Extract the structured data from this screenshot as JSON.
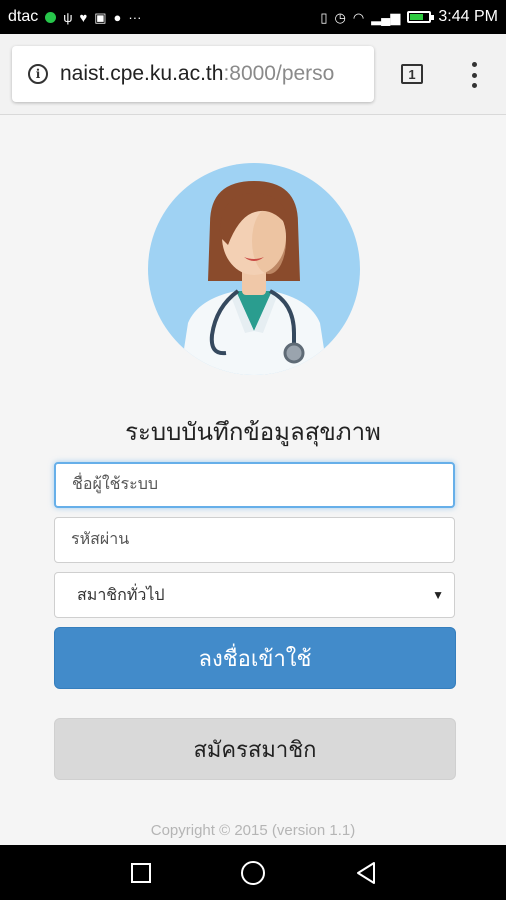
{
  "status_bar": {
    "carrier": "dtac",
    "time": "3:44 PM",
    "battery_level": 0.7,
    "icons": [
      "notification-dot-icon",
      "usb-icon",
      "health-icon",
      "app-icon",
      "chat-icon",
      "more-icon",
      "vibrate-icon",
      "alarm-icon",
      "wifi-icon",
      "signal-icon",
      "battery-icon"
    ],
    "more_glyph": "···"
  },
  "browser": {
    "url_host": "naist.cpe.ku.ac.th",
    "url_rest": ":8000/perso",
    "tab_count": "1"
  },
  "page": {
    "title": "ระบบบันทึกข้อมูลสุขภาพ",
    "username_placeholder": "ชื่อผู้ใช้ระบบ",
    "password_placeholder": "รหัสผ่าน",
    "member_type": "สมาชิกทั่วไป",
    "login_label": "ลงชื่อเข้าใช้",
    "register_label": "สมัครสมาชิก",
    "copyright": "Copyright © 2015 (version 1.1)"
  },
  "colors": {
    "primary": "#428bca",
    "avatar_bg": "#9fd2f3",
    "focus_border": "#66afe9",
    "secondary_button": "#d9d9d9"
  }
}
